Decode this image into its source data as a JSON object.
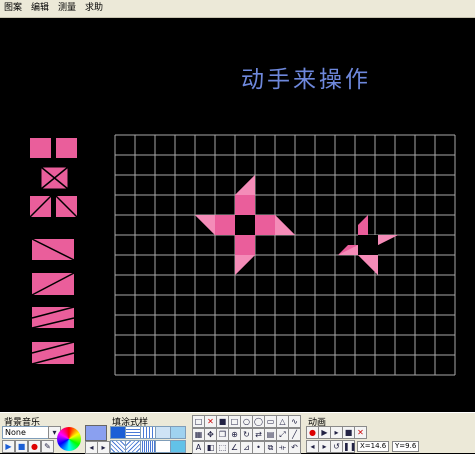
{
  "menu": [
    "图案",
    "编辑",
    "测量",
    "求助"
  ],
  "title": "动手来操作",
  "colors": {
    "pink": "#ea5e9b",
    "pink_light": "#f48cb8",
    "grid": "#a9a9a9",
    "title": "#6e88dc"
  },
  "bottom": {
    "music_label": "背景音乐",
    "music_value": "None",
    "fill_label": "填涂式样",
    "anim_label": "动画",
    "x_readout": "X=14.6",
    "y_readout": "Y=9.6"
  }
}
